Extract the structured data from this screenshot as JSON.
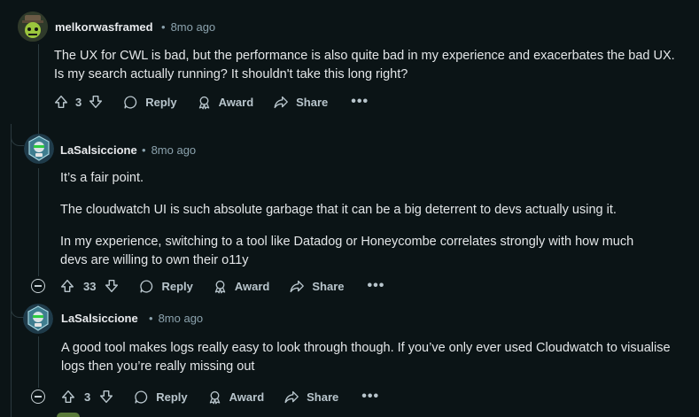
{
  "colors": {
    "background": "#0b1416",
    "text": "#e3e6e8",
    "muted": "#8ba2ad",
    "action": "#b8c5cc",
    "thread_line": "#2b3a3f"
  },
  "comments": [
    {
      "author": "melkorwasframed",
      "separator": "•",
      "time": "8mo ago",
      "paragraphs": [
        "The UX for CWL is bad, but the performance is also quite bad in my experience and exacerbates the bad UX. Is my search actually running? It shouldn't take this long right?"
      ],
      "actions": {
        "votes": "3",
        "reply": "Reply",
        "award": "Award",
        "share": "Share",
        "more": "•••"
      }
    },
    {
      "author": "LaSalsiccione",
      "separator": "•",
      "time": "8mo ago",
      "paragraphs": [
        "It’s a fair point.",
        "The cloudwatch UI is such absolute garbage that it can be a big deterrent to devs actually using it.",
        "In my experience, switching to a tool like Datadog or Honeycombe correlates strongly with how much devs are willing to own their o11y"
      ],
      "actions": {
        "votes": "33",
        "reply": "Reply",
        "award": "Award",
        "share": "Share",
        "more": "•••"
      }
    },
    {
      "author": "LaSalsiccione",
      "separator": "•",
      "time": "8mo ago",
      "paragraphs": [
        "A good tool makes logs really easy to look through though. If you’ve only ever used Cloudwatch to visualise logs then you’re really missing out"
      ],
      "actions": {
        "votes": "3",
        "reply": "Reply",
        "award": "Award",
        "share": "Share",
        "more": "•••"
      }
    }
  ],
  "icons": {
    "upvote": "arrow-up-icon",
    "downvote": "arrow-down-icon",
    "reply": "speech-bubble-icon",
    "award": "award-ribbon-icon",
    "share": "share-arrow-icon",
    "collapse": "minus-circle-icon"
  }
}
